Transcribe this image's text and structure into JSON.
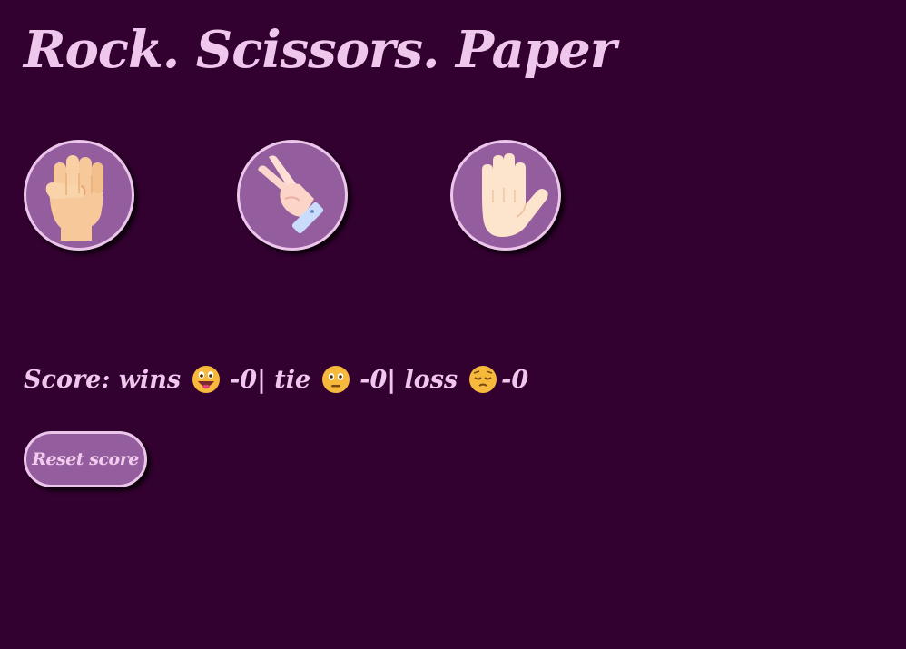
{
  "title": "Rock. Scissors. Paper",
  "moves": [
    {
      "name": "rock",
      "icon": "fist-hand-icon"
    },
    {
      "name": "scissors",
      "icon": "victory-hand-icon"
    },
    {
      "name": "paper",
      "icon": "open-hand-icon"
    }
  ],
  "score": {
    "prefix": "Score: wins",
    "wins_sep": "- ",
    "wins": "0",
    "tie_label": "| tie",
    "tie_sep": "- ",
    "tie": "0",
    "loss_label": "| loss",
    "loss_sep": "- ",
    "loss": "0",
    "wins_icon": "grinning-face-icon",
    "tie_icon": "neutral-face-icon",
    "loss_icon": "pensive-face-icon"
  },
  "reset_label": "Reset score",
  "colors": {
    "background": "#32012f",
    "button_fill": "#945d9e",
    "button_border": "#ecc6ea",
    "text": "#efc7ec"
  }
}
